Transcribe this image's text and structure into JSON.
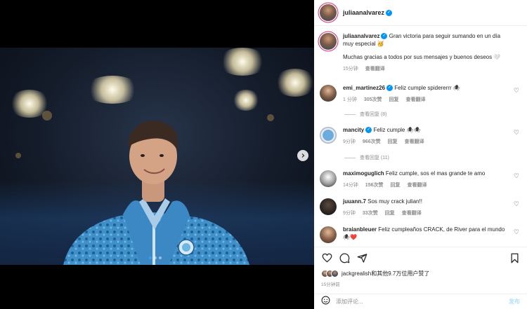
{
  "header": {
    "username": "juliaanalvarez"
  },
  "caption": {
    "username": "juliaanalvarez",
    "text": "Gran victoria para seguir sumando en un día muy especial 🥳",
    "text2": "Muchas gracias a todos por sus mensajes y buenos deseos 🤍",
    "time": "15分钟",
    "translate": "查看翻译"
  },
  "comments": [
    {
      "username": "emi_martinez26",
      "verified": true,
      "text": "Feliz cumple spidererrr 🕷",
      "time": "1 分钟",
      "likes": "305次赞",
      "reply": "回复",
      "translate": "查看翻译",
      "replies": "查看回复 (8)"
    },
    {
      "username": "mancity",
      "verified": true,
      "text": "Feliz cumple 🕷🕷",
      "time": "9分钟",
      "likes": "966次赞",
      "reply": "回复",
      "translate": "查看翻译",
      "replies": "查看回复 (11)"
    },
    {
      "username": "maximoguglich",
      "verified": false,
      "text": "Feliz cumple, sos el mas grande te amo",
      "time": "14分钟",
      "likes": "156次赞",
      "reply": "回复",
      "translate": "查看翻译"
    },
    {
      "username": "juuann.7",
      "verified": false,
      "text": "Sos muy crack julian!!",
      "time": "9分钟",
      "likes": "33次赞",
      "reply": "回复",
      "translate": "查看翻译"
    },
    {
      "username": "braianbleuer",
      "verified": false,
      "text": "Feliz cumpleaños CRACK, de River para el mundo 🕷❤️",
      "time": "",
      "likes": "",
      "reply": "",
      "translate": ""
    }
  ],
  "likes": {
    "text": "jackgrealish和其他9.7万位用户赞了"
  },
  "post_time": "15分钟前",
  "add_comment": {
    "placeholder": "添加评论...",
    "post_label": "发布"
  },
  "carousel": {
    "slides": 3,
    "active": 1
  },
  "colors": {
    "verified": "#0095f6",
    "link": "#b2dffc",
    "muted": "#8e8e8e"
  },
  "icons": [
    "heart-icon",
    "comment-icon",
    "share-icon",
    "bookmark-icon",
    "emoji-icon",
    "chevron-right-icon"
  ]
}
